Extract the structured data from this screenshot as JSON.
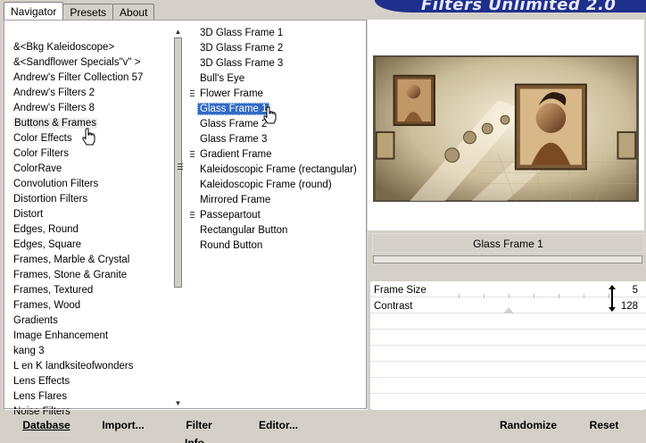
{
  "window": {
    "title": "Filters Unlimited 2.0"
  },
  "tabs": [
    {
      "label": "Navigator",
      "active": true
    },
    {
      "label": "Presets",
      "active": false
    },
    {
      "label": "About",
      "active": false
    }
  ],
  "categories": [
    "&<Bkg Kaleidoscope>",
    "&<Sandflower Specials\"v\" >",
    "Andrew's Filter Collection 57",
    "Andrew's Filters 2",
    "Andrew's Filters 8",
    "Buttons & Frames",
    "Color Effects",
    "Color Filters",
    "ColorRave",
    "Convolution Filters",
    "Distortion Filters",
    "Distort",
    "Edges, Round",
    "Edges, Square",
    "Frames, Marble & Crystal",
    "Frames, Stone & Granite",
    "Frames, Textured",
    "Frames, Wood",
    "Gradients",
    "Image Enhancement",
    "kang 3",
    "L en K landksiteofwonders",
    "Lens Effects",
    "Lens Flares",
    "Noise Filters"
  ],
  "selected_category": "Buttons & Frames",
  "filters": [
    {
      "label": "3D Glass Frame 1",
      "grip": false
    },
    {
      "label": "3D Glass Frame 2",
      "grip": false
    },
    {
      "label": "3D Glass Frame 3",
      "grip": false
    },
    {
      "label": "Bull's Eye",
      "grip": false
    },
    {
      "label": "Flower Frame",
      "grip": true
    },
    {
      "label": "Glass Frame 1",
      "grip": false
    },
    {
      "label": "Glass Frame 2",
      "grip": false
    },
    {
      "label": "Glass Frame 3",
      "grip": false
    },
    {
      "label": "Gradient Frame",
      "grip": true
    },
    {
      "label": "Kaleidoscopic Frame (rectangular)",
      "grip": false
    },
    {
      "label": "Kaleidoscopic Frame (round)",
      "grip": false
    },
    {
      "label": "Mirrored Frame",
      "grip": false
    },
    {
      "label": "Passepartout",
      "grip": true
    },
    {
      "label": "Rectangular Button",
      "grip": false
    },
    {
      "label": "Round Button",
      "grip": false
    }
  ],
  "selected_filter": "Glass Frame 1",
  "filter_name_display": "Glass Frame 1",
  "params": [
    {
      "label": "Frame Size",
      "value": "5"
    },
    {
      "label": "Contrast",
      "value": "128"
    }
  ],
  "buttons_left": {
    "database": "Database",
    "import": "Import...",
    "filter_info": "Filter Info...",
    "editor": "Editor..."
  },
  "buttons_right": {
    "randomize": "Randomize",
    "reset": "Reset"
  },
  "colors": {
    "selection": "#316ac5",
    "banner": "#1e2f8c",
    "dialog_bg": "#d4d0c8"
  }
}
